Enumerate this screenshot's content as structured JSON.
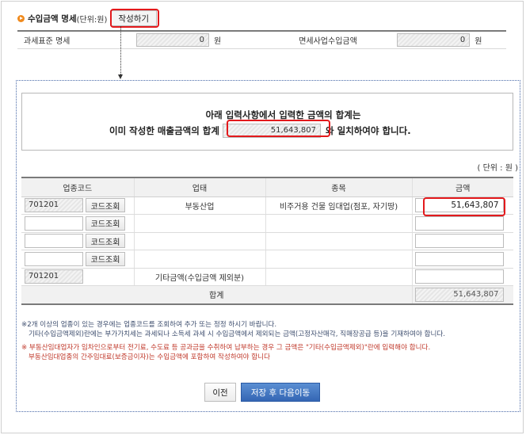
{
  "header": {
    "title": "수입금액 명세",
    "unit": "(단위:원)",
    "write_button": "작성하기"
  },
  "summary": {
    "label1": "과세표준 명세",
    "value1": "0",
    "won1": "원",
    "label2": "면세사업수입금액",
    "value2": "0",
    "won2": "원"
  },
  "notice": {
    "line1": "아래 입력사항에서  입력한 금액의 합계는",
    "line2_pre": "이미 작성한 매출금액의 합계",
    "sales_total": "51,643,807",
    "line2_post": "와 일치하여야 합니다."
  },
  "unit_label": "( 단위 : 원 )",
  "table": {
    "headers": [
      "업종코드",
      "업태",
      "종목",
      "금액"
    ],
    "lookup_label": "코드조회",
    "rows": [
      {
        "code": "701201",
        "business": "부동산업",
        "item": "비주거용 건물 임대업(점포, 자기땅)",
        "amount": "51,643,807"
      },
      {
        "code": "",
        "business": "",
        "item": "",
        "amount": ""
      },
      {
        "code": "",
        "business": "",
        "item": "",
        "amount": ""
      },
      {
        "code": "",
        "business": "",
        "item": "",
        "amount": ""
      }
    ],
    "other_row": {
      "code": "701201",
      "business": "기타금액(수입금액 제외분)",
      "item": "",
      "amount": ""
    },
    "total_label": "합계",
    "total_amount": "51,643,807"
  },
  "notes": {
    "n1a": "※2개 이상의 업종이 있는 경우에는 업종코드를 조회하여 추가 또는 정정 하시기 바랍니다.",
    "n1b": "기타(수입금액제외)란에는 부가가치세는 과세되나 소득세 과세 시 수입금액에서 제외되는 금액(고정자산매각, 직매장공급 등)을 기재하여야 합니다.",
    "n2a": "※ 부동산임대업자가 임차인으로부터 전기료, 수도료 등 공과금을 수취하여 납부하는 경우 그 금액은 \"기타(수입금액제외)\"란에 입력해야 합니다.",
    "n2b": "부동산임대업종의 간주임대료(보증금이자)는 수입금액에 포함하여 작성하여야 합니다"
  },
  "buttons": {
    "prev": "이전",
    "save_next": "저장 후 다음이동"
  },
  "colors": {
    "highlight": "#e3191c",
    "primary_button": "#3466b4",
    "bullet": "#f08a1d"
  }
}
